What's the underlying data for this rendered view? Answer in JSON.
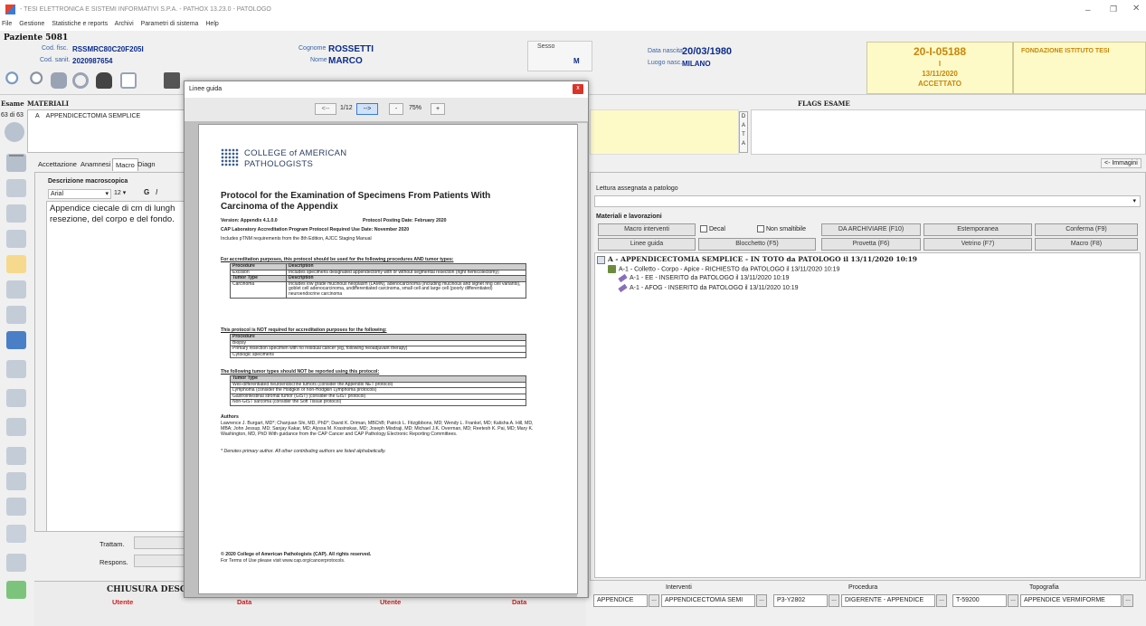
{
  "app": {
    "title": "- TESI ELETTRONICA E SISTEMI INFORMATIVI S.P.A. - PATHOX 13.23.0 - PATOLOGO",
    "menu": [
      "File",
      "Gestione",
      "Statistiche e reports",
      "Archivi",
      "Parametri di sistema",
      "Help"
    ]
  },
  "patient": {
    "title": "Paziente 5081",
    "cod_fisc_label": "Cod. fisc.",
    "cod_fisc": "RSSMRC80C20F205I",
    "cod_sanit_label": "Cod. sanit.",
    "cod_sanit": "2020987654",
    "cognome_label": "Cognome",
    "cognome": "ROSSETTI",
    "nome_label": "Nome",
    "nome": "MARCO",
    "sesso_label": "Sesso",
    "sesso": "M",
    "nascita_label": "Data nascita",
    "nascita": "20/03/1980",
    "luogo_label": "Luogo nasc.",
    "luogo": "MILANO",
    "exam_code": "20-I-05188",
    "exam_type": "I",
    "exam_date": "13/11/2020",
    "exam_status": "ACCETTATO",
    "institute": "FONDAZIONE ISTITUTO TESI"
  },
  "exam": {
    "esame_label": "Esame",
    "count": "63 di 63",
    "materiali_label": "MATERIALI",
    "material_row": "A    APPENDICECTOMIA SEMPLICE",
    "flags_label": "FLAGS ESAME",
    "data_letters": [
      "D",
      "A",
      "T",
      "A"
    ],
    "immagini_btn": "<- Immagini"
  },
  "tabs": [
    "Accettazione",
    "Anamnesi",
    "Macro",
    "Diagn"
  ],
  "macro": {
    "label": "Descrizione macroscopica",
    "font": "Arial",
    "size": "12",
    "bold": "G",
    "italic": "I",
    "text_line1": "Appendice ciecale di cm di lungh",
    "text_line2": "resezione, del corpo e del fondo."
  },
  "trattam_label": "Trattam.",
  "respons_label": "Respons.",
  "chiusura": {
    "title": "CHIUSURA DESCR",
    "utente": "Utente",
    "data": "Data",
    "utente2": "Utente",
    "data2": "Data"
  },
  "dialog": {
    "title": "Linee guida",
    "prev": "<--",
    "page": "1/12",
    "next": "-->",
    "minus": "-",
    "zoom": "75%",
    "plus": "+",
    "close": "x"
  },
  "pdf": {
    "logo_line1": "COLLEGE of AMERICAN",
    "logo_line2": "PATHOLOGISTS",
    "title": "Protocol for the Examination of Specimens From Patients With Carcinoma of the Appendix",
    "version": "Version: Appendix 4.1.0.0",
    "posting": "Protocol Posting Date: February 2020",
    "cap_line": "CAP Laboratory Accreditation Program Protocol Required Use Date: November 2020",
    "ptnm": "Includes pTNM requirements from the 8th Edition, AJCC Staging Manual",
    "accred_head": "For accreditation purposes, this protocol should be used for the following procedures AND tumor types:",
    "t1_h1": "Procedure",
    "t1_h2": "Description",
    "t1_r1c1": "Excision",
    "t1_r1c2": "Includes specimens designated appendectomy with or without segmental resection (right hemicolectomy)",
    "t1_h3": "Tumor Type",
    "t1_h4": "Description",
    "t1_r2c1": "Carcinoma",
    "t1_r2c2": "Includes low grade mucinous neoplasm (LAMN), adenocarcinoma (including mucinous and signet ring cell variants), goblet cell adenocarcinoma, undifferentiated carcinoma, small cell and large cell (poorly differentiated) neuroendocrine carcinoma",
    "not_required_head": "This protocol is NOT required for accreditation purposes for the following:",
    "t2_h": "Procedure",
    "t2_rows": [
      "Biopsy",
      "Primary resection specimen with no residual cancer (eg, following neoadjuvant therapy)",
      "Cytologic specimens"
    ],
    "not_report_head": "The following tumor types should NOT be reported using this protocol:",
    "t3_h": "Tumor Type",
    "t3_rows": [
      "Well-differentiated neuroendocrine tumors (consider the Appendix NET protocol)",
      "Lymphoma (consider the Hodgkin or non-Hodgkin Lymphoma protocols)",
      "Gastrointestinal stromal tumor (GIST) (consider the GIST protocol)",
      "Non-GIST sarcoma (consider the Soft Tissue protocol)"
    ],
    "authors_head": "Authors",
    "authors_text": "Lawrence J. Burgart, MD*; Chanjuan Shi, MD, PhD*; David K. Driman, MBChB; Patrick L. Fitzgibbons, MD; Wendy L. Frankel, MD; Kalisha A. Hill, MD, MBA; John Jessup, MD; Sanjay Kakar, MD; Alyssa M. Krasinskas, MD; Joseph Misdraji, MD; Michael J.K. Overman, MD; Reetesh K. Pai, MD; Mary K. Washington, MD, PhD With guidance from the CAP Cancer and CAP Pathology Electronic Reporting Committees.",
    "authors_note": "* Denotes primary author. All other contributing authors are listed alphabetically.",
    "copyright": "© 2020 College of American Pathologists (CAP). All rights reserved.",
    "terms": "For Terms of Use please visit www.cap.org/cancerprotocols."
  },
  "right": {
    "lettura_label": "Lettura assegnata a patologo",
    "materiali_label": "Materiali e lavorazioni",
    "row1": [
      "Macro interventi",
      "Decal",
      "Non smaltibile",
      "DA ARCHIVIARE (F10)",
      "Estemporanea",
      "Conferma (F9)"
    ],
    "row2": [
      "Linee guida",
      "Blocchetto (F5)",
      "Provetta (F6)",
      "Vetrino (F7)",
      "Macro (F8)"
    ],
    "tree": [
      "A - APPENDICECTOMIA SEMPLICE - IN TOTO da PATOLOGO il 13/11/2020 10:19",
      "A-1 - Colletto - Corpo - Apice - RICHIESTO da PATOLOGO il 13/11/2020 10:19",
      "A-1 - EE - INSERITO da PATOLOGO il 13/11/2020 10:19",
      "A-1 - AFOG - INSERITO da PATOLOGO il 13/11/2020 10:19"
    ]
  },
  "bottom": {
    "interventi_label": "Interventi",
    "procedura_label": "Procedura",
    "topografia_label": "Topografia",
    "f1": "APPENDICE",
    "f2": "APPENDICECTOMIA SEMI",
    "f3": "P3-Y2802",
    "f4": "DIGERENTE - APPENDICE",
    "f5": "T-59200",
    "f6": "APPENDICE VERMIFORME",
    "dots": "..."
  },
  "colors": {
    "accent_blue": "#0b2c8c",
    "yellow_panel": "#fdfac8",
    "red_label": "#cc2222",
    "gold_text": "#c8860a"
  }
}
